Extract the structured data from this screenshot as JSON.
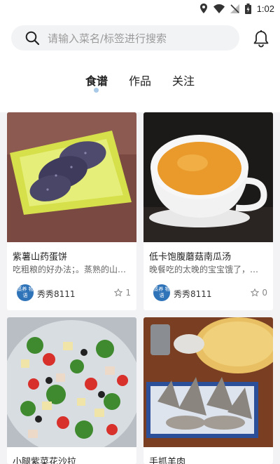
{
  "status_bar": {
    "time": "1:02",
    "icons": [
      "location-icon",
      "wifi-icon",
      "no-signal-icon",
      "battery-icon"
    ]
  },
  "search": {
    "placeholder": "请输入菜名/标签进行搜索"
  },
  "tabs": [
    {
      "label": "食谱",
      "active": true
    },
    {
      "label": "作品",
      "active": false
    },
    {
      "label": "关注",
      "active": false
    }
  ],
  "cards": [
    {
      "title": "紫薯山药蛋饼",
      "desc": "吃粗粮的好办法；。蒸熟的山药和紫薯",
      "author": "秀秀8111",
      "avatar_text": "蒸养 物语",
      "likes": "1",
      "image": "purple-pancake-photo"
    },
    {
      "title": "低卡饱腹蘑菇南瓜汤",
      "desc": "晚餐吃的太晚的宝宝饿了，来一碗",
      "author": "秀秀8111",
      "avatar_text": "蒸养 物语",
      "likes": "0",
      "image": "pumpkin-soup-photo"
    },
    {
      "title": "小腿紫菜花沙拉",
      "image": "salad-photo"
    },
    {
      "title": "手抓羊肉",
      "image": "mutton-photo"
    }
  ],
  "colors": {
    "accent_dot": "#a9c9e8",
    "avatar_bg": "#2f73b8",
    "background": "#f3f3f5"
  }
}
